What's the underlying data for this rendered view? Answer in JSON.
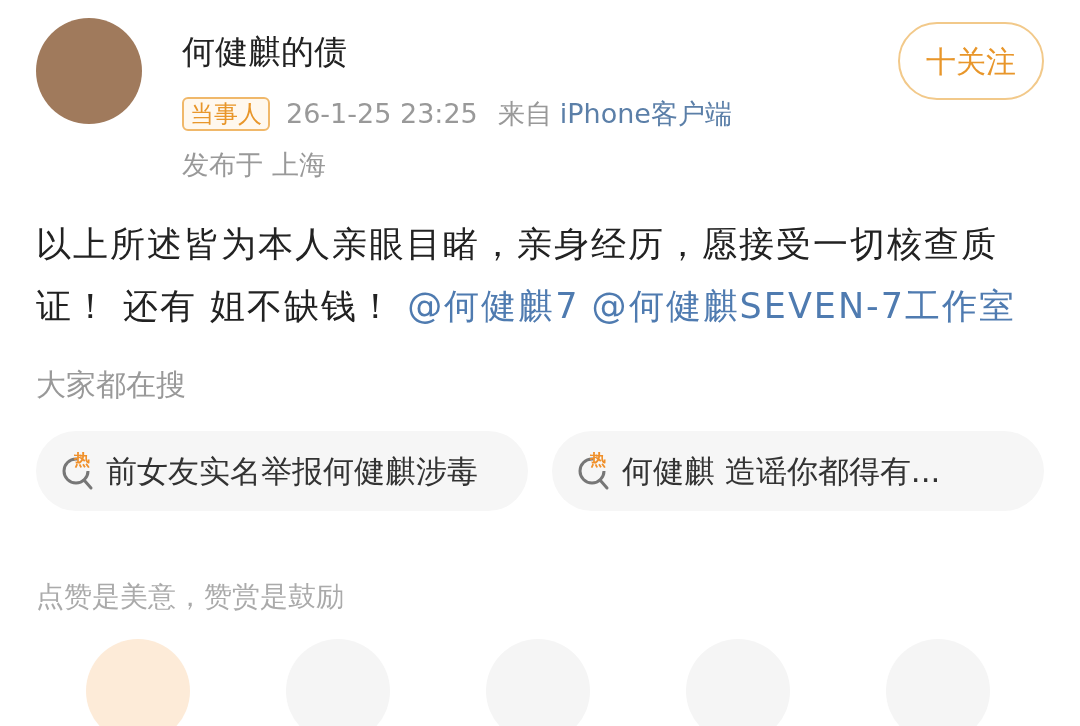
{
  "post": {
    "author": "何健麒的债",
    "follow_button": "十关注",
    "badge": "当事人",
    "time": "26-1-25 23:25",
    "source_prefix": "来自",
    "source": "iPhone客户端",
    "location": "发布于 上海",
    "body": [
      {
        "kind": "plain",
        "text": "以上所述皆为本人亲眼目睹，亲身经历，愿接受一切核查质证！ 还有 姐不缺钱！"
      },
      {
        "kind": "mention",
        "text": "@何健麒7"
      },
      {
        "kind": "mention",
        "text": "@何健麒SEVEN-7工作室"
      }
    ]
  },
  "searches": {
    "title": "大家都在搜",
    "items": [
      {
        "hot_label": "热",
        "text": "前女友实名举报何健麒涉毒"
      },
      {
        "hot_label": "热",
        "text": "何健麒 造谣你都得有..."
      }
    ]
  },
  "reward": {
    "text": "点赞是美意，赞赏是鼓励",
    "tippers": [
      {
        "selected": true
      },
      {
        "selected": false
      },
      {
        "selected": false
      },
      {
        "selected": false
      },
      {
        "selected": false
      }
    ]
  }
}
